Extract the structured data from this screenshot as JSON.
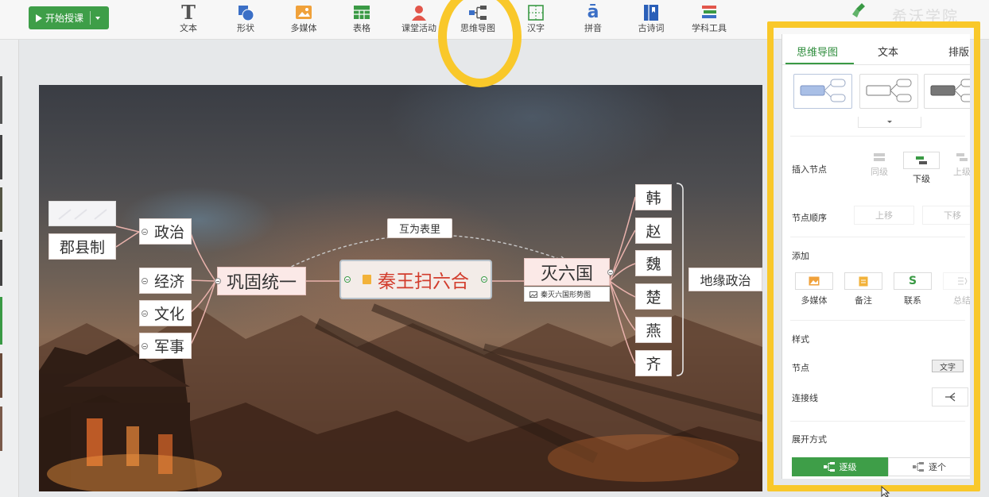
{
  "toolbar": {
    "start_label": "开始授课",
    "tools": [
      {
        "label": "文本",
        "icon": "text-icon"
      },
      {
        "label": "形状",
        "icon": "shape-icon"
      },
      {
        "label": "多媒体",
        "icon": "media-icon"
      },
      {
        "label": "表格",
        "icon": "table-icon"
      },
      {
        "label": "课堂活动",
        "icon": "activity-icon"
      },
      {
        "label": "思维导图",
        "icon": "mindmap-icon"
      },
      {
        "label": "汉字",
        "icon": "hanzi-icon"
      },
      {
        "label": "拼音",
        "icon": "pinyin-icon"
      },
      {
        "label": "古诗词",
        "icon": "poem-icon"
      },
      {
        "label": "学科工具",
        "icon": "subject-tools-icon"
      }
    ],
    "brand_text": "希沃学院",
    "colors": {
      "accent": "#3e9e48",
      "highlight": "#f9c82a"
    }
  },
  "mindmap": {
    "center": "秦王扫六合",
    "left_branch": "巩固统一",
    "left_children": [
      "政治",
      "经济",
      "文化",
      "军事"
    ],
    "politics_child": "郡县制",
    "right_branch": "灭六国",
    "right_attachment": "秦灭六国形势图",
    "states": [
      "韩",
      "赵",
      "魏",
      "楚",
      "燕",
      "齐"
    ],
    "summary": "地缘政治",
    "relation_label": "互为表里"
  },
  "panel": {
    "tabs": [
      "思维导图",
      "文本",
      "排版"
    ],
    "active_tab": "思维导图",
    "insert_node": {
      "label": "插入节点",
      "buttons": [
        "同级",
        "下级",
        "上级"
      ]
    },
    "node_order": {
      "label": "节点顺序",
      "buttons": [
        "上移",
        "下移"
      ]
    },
    "add": {
      "label": "添加",
      "items": [
        "多媒体",
        "备注",
        "联系",
        "总结"
      ]
    },
    "style": {
      "label": "样式",
      "node_label": "节点",
      "node_value": "文字",
      "line_label": "连接线"
    },
    "expand": {
      "label": "展开方式",
      "options": [
        "逐级",
        "逐个"
      ],
      "active": "逐级"
    }
  }
}
